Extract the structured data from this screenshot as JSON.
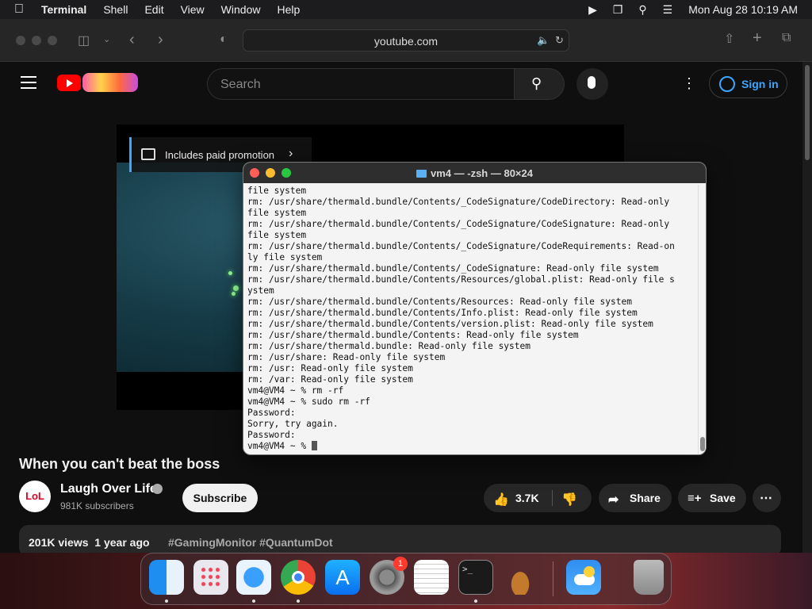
{
  "menubar": {
    "app_name": "Terminal",
    "menus": [
      "Shell",
      "Edit",
      "View",
      "Window",
      "Help"
    ],
    "clock": "Mon Aug 28  10:19 AM"
  },
  "safari": {
    "url": "youtube.com"
  },
  "youtube": {
    "search_placeholder": "Search",
    "sign_in_label": "Sign in",
    "promo_label": "Includes paid promotion",
    "video_title": "When you can't beat the boss",
    "channel_name": "Laugh Over Life",
    "avatar_text": "LoL",
    "subscribers": "981K subscribers",
    "subscribe_label": "Subscribe",
    "like_count": "3.7K",
    "share_label": "Share",
    "save_label": "Save",
    "views": "201K views",
    "age": "1 year ago",
    "hashtags": "#GamingMonitor #QuantumDot"
  },
  "terminal": {
    "title": "vm4 — -zsh — 80×24",
    "lines": [
      "file system",
      "rm: /usr/share/thermald.bundle/Contents/_CodeSignature/CodeDirectory: Read-only",
      "file system",
      "rm: /usr/share/thermald.bundle/Contents/_CodeSignature/CodeSignature: Read-only",
      "file system",
      "rm: /usr/share/thermald.bundle/Contents/_CodeSignature/CodeRequirements: Read-on",
      "ly file system",
      "rm: /usr/share/thermald.bundle/Contents/_CodeSignature: Read-only file system",
      "rm: /usr/share/thermald.bundle/Contents/Resources/global.plist: Read-only file s",
      "ystem",
      "rm: /usr/share/thermald.bundle/Contents/Resources: Read-only file system",
      "rm: /usr/share/thermald.bundle/Contents/Info.plist: Read-only file system",
      "rm: /usr/share/thermald.bundle/Contents/version.plist: Read-only file system",
      "rm: /usr/share/thermald.bundle/Contents: Read-only file system",
      "rm: /usr/share/thermald.bundle: Read-only file system",
      "rm: /usr/share: Read-only file system",
      "rm: /usr: Read-only file system",
      "rm: /var: Read-only file system",
      "vm4@VM4 ~ % rm -rf",
      "vm4@VM4 ~ % sudo rm -rf",
      "Password:",
      "Sorry, try again.",
      "Password:"
    ],
    "prompt": "vm4@VM4 ~ % "
  },
  "dock": {
    "apps": [
      "Finder",
      "Launchpad",
      "Safari",
      "Chrome",
      "App Store",
      "System Settings",
      "TextEdit",
      "Terminal",
      "GarageBand",
      "Weather",
      "Trash"
    ],
    "settings_badge": "1"
  },
  "colors": {
    "yt_red": "#ff0000",
    "link_blue": "#3ea6ff",
    "terminal_bg": "#f4f4f4"
  }
}
